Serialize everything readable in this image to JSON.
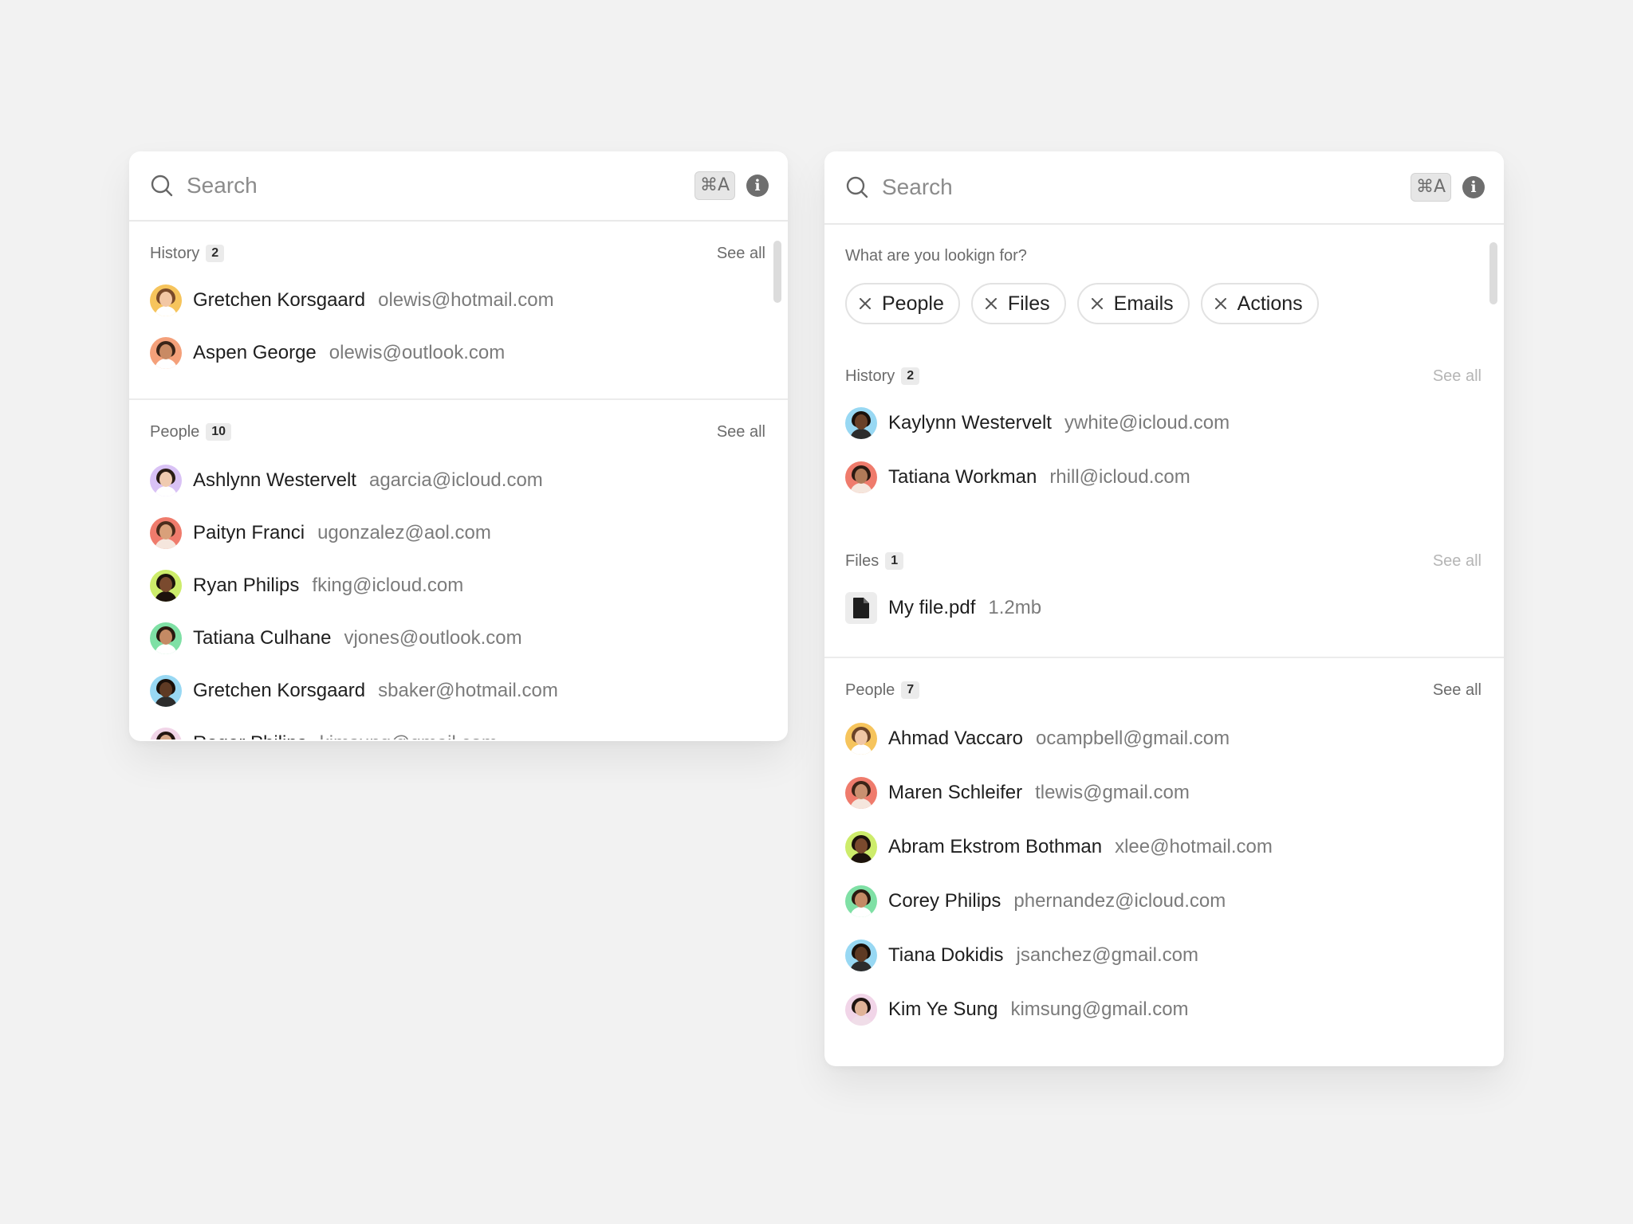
{
  "left": {
    "search": {
      "placeholder": "Search",
      "shortcut": "⌘A"
    },
    "history": {
      "title": "History",
      "count": "2",
      "see_all": "See all",
      "items": [
        {
          "name": "Gretchen Korsgaard",
          "email": "olewis@hotmail.com",
          "avatar_bg": "#f6c45c",
          "skin": "#f3c7a4",
          "hair": "#7a4a2a",
          "shirt": "#ffffff"
        },
        {
          "name": "Aspen George",
          "email": "olewis@outlook.com",
          "avatar_bg": "#f4a07a",
          "skin": "#c98a64",
          "hair": "#3a2418",
          "shirt": "#ffffff"
        }
      ]
    },
    "people": {
      "title": "People",
      "count": "10",
      "see_all": "See all",
      "items": [
        {
          "name": "Ashlynn Westervelt",
          "email": "agarcia@icloud.com",
          "avatar_bg": "#d9c2f5",
          "skin": "#f0cbb0",
          "hair": "#2b1d14",
          "shirt": "#ffffff"
        },
        {
          "name": "Paityn Franci",
          "email": "ugonzalez@aol.com",
          "avatar_bg": "#ef7b6c",
          "skin": "#d9a07a",
          "hair": "#4a2c1c",
          "shirt": "#f5e6dd"
        },
        {
          "name": "Ryan Philips",
          "email": "fking@icloud.com",
          "avatar_bg": "#cdec6b",
          "skin": "#7a4a2e",
          "hair": "#1c120c",
          "shirt": "#1c120c"
        },
        {
          "name": "Tatiana Culhane",
          "email": "vjones@outlook.com",
          "avatar_bg": "#7fe0a5",
          "skin": "#c48a64",
          "hair": "#2a1a10",
          "shirt": "#ffffff"
        },
        {
          "name": "Gretchen Korsgaard",
          "email": "sbaker@hotmail.com",
          "avatar_bg": "#98d8f3",
          "skin": "#5e3a24",
          "hair": "#1a100a",
          "shirt": "#2c2c2c"
        },
        {
          "name": "Roger Philips",
          "email": "kimsung@gmail.com",
          "avatar_bg": "#f1d5e8",
          "skin": "#d7a889",
          "hair": "#231611",
          "shirt": "#f0dde8"
        }
      ]
    }
  },
  "right": {
    "search": {
      "placeholder": "Search",
      "shortcut": "⌘A"
    },
    "filters": {
      "prompt": "What are you lookign for?",
      "chips": [
        "People",
        "Files",
        "Emails",
        "Actions"
      ]
    },
    "history": {
      "title": "History",
      "count": "2",
      "see_all": "See all",
      "items": [
        {
          "name": "Kaylynn Westervelt",
          "email": "ywhite@icloud.com",
          "avatar_bg": "#98d8f3",
          "skin": "#6a4128",
          "hair": "#1a100a",
          "shirt": "#2c2c2c"
        },
        {
          "name": "Tatiana Workman",
          "email": "rhill@icloud.com",
          "avatar_bg": "#ef7b6c",
          "skin": "#b07a58",
          "hair": "#2b1a12",
          "shirt": "#f5e6dd"
        }
      ]
    },
    "files": {
      "title": "Files",
      "count": "1",
      "see_all": "See all",
      "items": [
        {
          "name": "My file.pdf",
          "size": "1.2mb"
        }
      ]
    },
    "people": {
      "title": "People",
      "count": "7",
      "see_all": "See all",
      "items": [
        {
          "name": "Ahmad Vaccaro",
          "email": "ocampbell@gmail.com",
          "avatar_bg": "#f6c45c",
          "skin": "#f0c6a4",
          "hair": "#6b4328",
          "shirt": "#ffffff"
        },
        {
          "name": "Maren Schleifer",
          "email": "tlewis@gmail.com",
          "avatar_bg": "#ef7b6c",
          "skin": "#c99070",
          "hair": "#3b2417",
          "shirt": "#f5e6dd"
        },
        {
          "name": "Abram Ekstrom Bothman",
          "email": "xlee@hotmail.com",
          "avatar_bg": "#cdec6b",
          "skin": "#7a4a2e",
          "hair": "#1c120c",
          "shirt": "#1c120c"
        },
        {
          "name": "Corey Philips",
          "email": "phernandez@icloud.com",
          "avatar_bg": "#7fe0a5",
          "skin": "#c48a64",
          "hair": "#2a1a10",
          "shirt": "#ffffff"
        },
        {
          "name": "Tiana Dokidis",
          "email": "jsanchez@gmail.com",
          "avatar_bg": "#98d8f3",
          "skin": "#5e3a24",
          "hair": "#1a100a",
          "shirt": "#2c2c2c"
        },
        {
          "name": "Kim Ye Sung",
          "email": "kimsung@gmail.com",
          "avatar_bg": "#f1d5e8",
          "skin": "#e0b398",
          "hair": "#1e1410",
          "shirt": "#f0dde8"
        }
      ]
    }
  }
}
